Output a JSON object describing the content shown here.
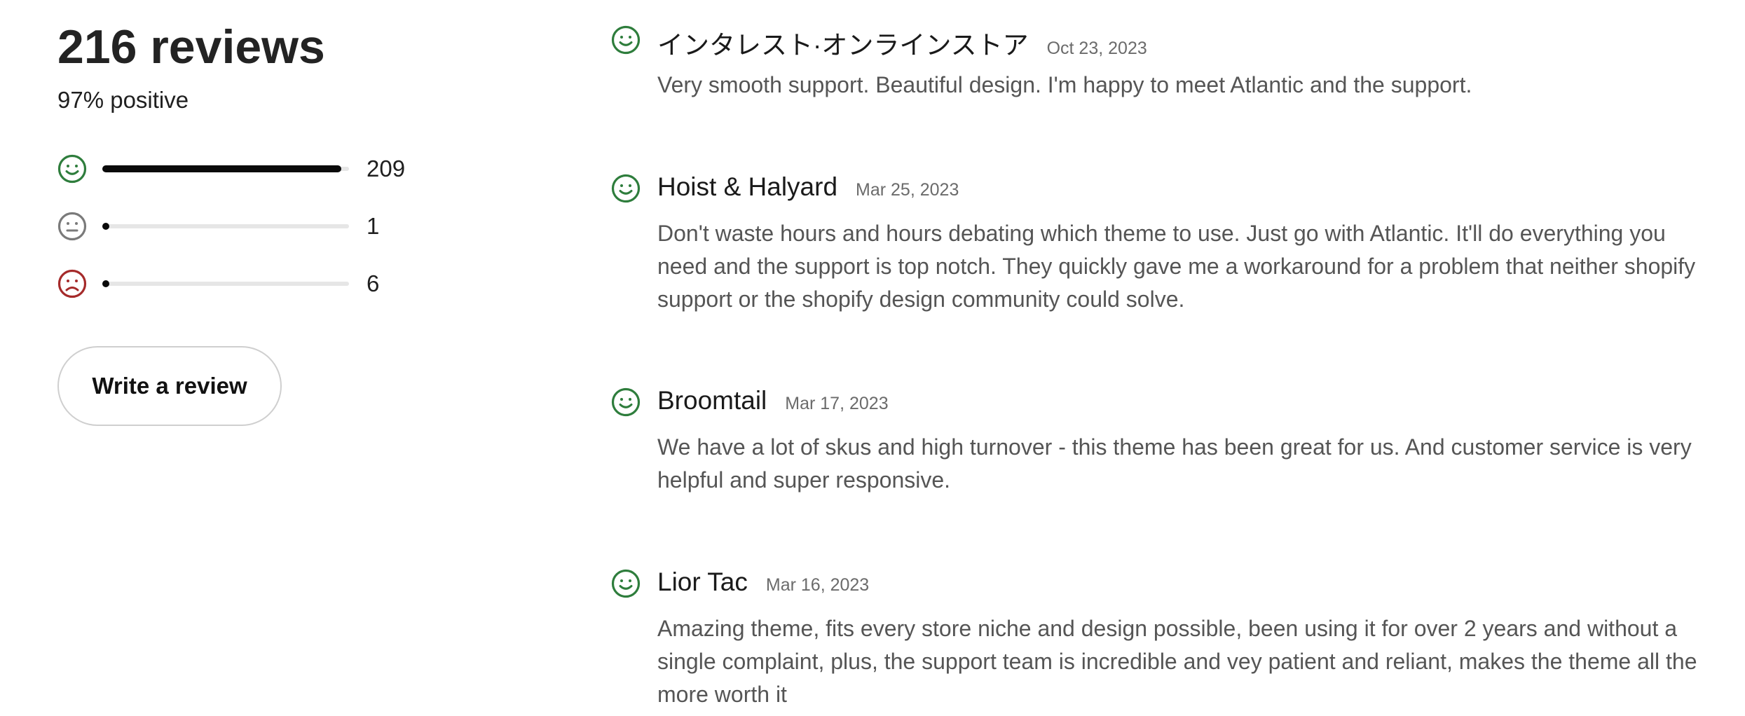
{
  "summary": {
    "title": "216 reviews",
    "positive": "97% positive",
    "write_label": "Write a review"
  },
  "breakdown": [
    {
      "sentiment": "positive",
      "icon": "smile-face-icon",
      "color": "#2e7d3c",
      "count": "209",
      "fraction": 0.97
    },
    {
      "sentiment": "neutral",
      "icon": "neutral-face-icon",
      "color": "#7a7a7a",
      "count": "1",
      "fraction": 0.005
    },
    {
      "sentiment": "negative",
      "icon": "frown-face-icon",
      "color": "#a52a2a",
      "count": "6",
      "fraction": 0.028
    }
  ],
  "reviews": [
    {
      "name": "インタレスト·オンラインストア",
      "date": "Oct 23, 2023",
      "text": "Very smooth support. Beautiful design. I'm happy to meet Atlantic and the support.",
      "sentiment": "positive",
      "icon": "smile-face-icon"
    },
    {
      "name": "Hoist & Halyard",
      "date": "Mar 25, 2023",
      "text": "Don't waste hours and hours debating which theme to use. Just go with Atlantic. It'll do everything you need and the support is top notch. They quickly gave me a workaround for a problem that neither shopify support or the shopify design community could solve.",
      "sentiment": "positive",
      "icon": "smile-face-icon"
    },
    {
      "name": "Broomtail",
      "date": "Mar 17, 2023",
      "text": "We have a lot of skus and high turnover - this theme has been great for us. And customer service is very helpful and super responsive.",
      "sentiment": "positive",
      "icon": "smile-face-icon"
    },
    {
      "name": "Lior Tac",
      "date": "Mar 16, 2023",
      "text": "Amazing theme, fits every store niche and design possible, been using it for over 2 years and without a single complaint, plus, the support team is incredible and vey patient and reliant, makes the theme all the more worth it",
      "sentiment": "positive",
      "icon": "smile-face-icon"
    }
  ]
}
